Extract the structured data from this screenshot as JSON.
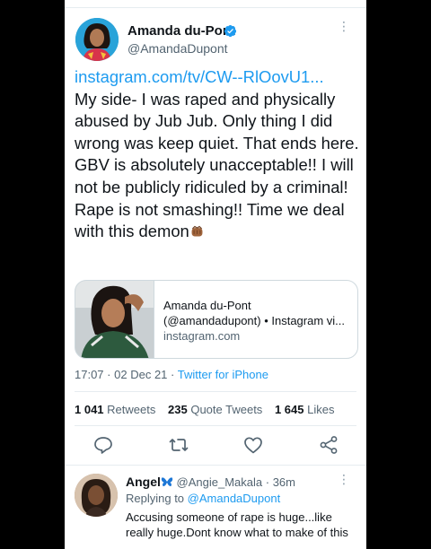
{
  "tweet": {
    "author_name": "Amanda du-Pont",
    "author_handle": "@AmandaDupont",
    "verified": true,
    "link": "instagram.com/tv/CW--RlOovU1...",
    "text": "My side- I was raped and physically abused by Jub Jub. Only thing I did wrong was keep quiet. That ends here. GBV is absolutely unacceptable!! I will not be publicly ridiculed by a criminal! Rape is not smashing!! Time we deal with this demon",
    "trailing_emoji": "fist-emoji",
    "card": {
      "title": "Amanda du-Pont",
      "description": "(@amandadupont) • Instagram vi...",
      "domain": "instagram.com"
    },
    "time": "17:07",
    "date": "02 Dec 21",
    "separator": "·",
    "source": "Twitter for iPhone",
    "stats": {
      "retweets_count": "1 041",
      "retweets_label": "Retweets",
      "quotes_count": "235",
      "quotes_label": "Quote Tweets",
      "likes_count": "1 645",
      "likes_label": "Likes"
    },
    "actions": [
      "reply-icon",
      "retweet-icon",
      "like-icon",
      "share-icon"
    ]
  },
  "reply": {
    "name": "Angel",
    "name_emoji": "butterfly-icon",
    "handle": "@Angie_Makala",
    "separator": "·",
    "time": "36m",
    "replying_label": "Replying to",
    "replying_to": "@AmandaDupont",
    "text": "Accusing someone of rape is huge...like really huge.Dont know what to make of this"
  },
  "colors": {
    "accent": "#1d9bf0",
    "text_primary": "#0f1419",
    "text_secondary": "#536471",
    "divider": "#e6ecf0"
  }
}
